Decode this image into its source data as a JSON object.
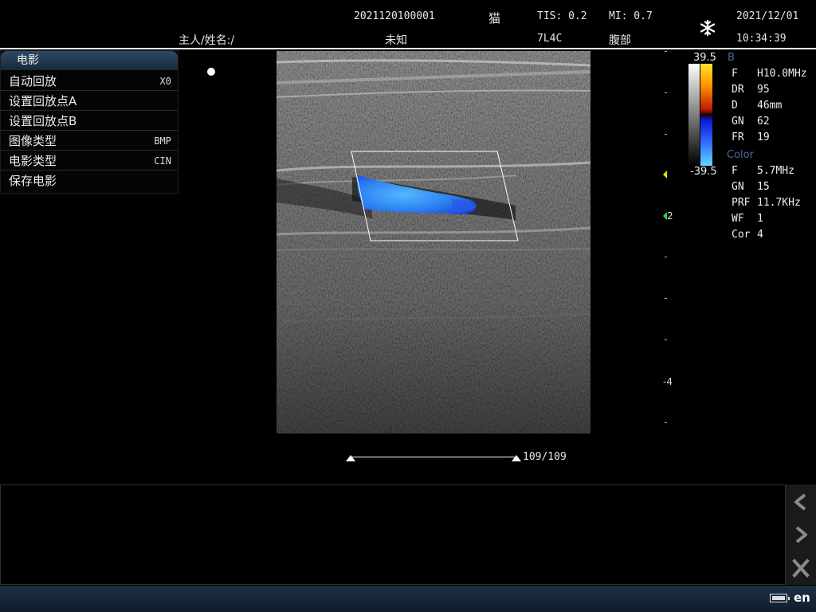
{
  "header": {
    "patient_id": "2021120100001",
    "species": "猫",
    "tis": "TIS: 0.2",
    "mi": "MI: 0.7",
    "date": "2021/12/01",
    "owner_label": "主人/姓名:/",
    "name_value": "未知",
    "probe": "7L4C",
    "exam": "腹部",
    "time": "10:34:39",
    "freeze_icon": "snowflake-icon"
  },
  "menu": {
    "title": "电影",
    "items": [
      {
        "label": "自动回放",
        "value": "X0"
      },
      {
        "label": "设置回放点A",
        "value": ""
      },
      {
        "label": "设置回放点B",
        "value": ""
      },
      {
        "label": "图像类型",
        "value": "BMP"
      },
      {
        "label": "电影类型",
        "value": "CIN"
      },
      {
        "label": "保存电影",
        "value": ""
      }
    ]
  },
  "colorbar": {
    "max": "39.5",
    "min": "-39.5"
  },
  "params": {
    "b_title": "B",
    "b": [
      {
        "k": "F",
        "v": "H10.0MHz"
      },
      {
        "k": "DR",
        "v": "95"
      },
      {
        "k": "D",
        "v": "46mm"
      },
      {
        "k": "GN",
        "v": "62"
      },
      {
        "k": "FR",
        "v": "19"
      }
    ],
    "color_title": "Color",
    "color": [
      {
        "k": "F",
        "v": "5.7MHz"
      },
      {
        "k": "GN",
        "v": "15"
      },
      {
        "k": "PRF",
        "v": "11.7KHz"
      },
      {
        "k": "WF",
        "v": "1"
      },
      {
        "k": "Cor",
        "v": "4"
      }
    ]
  },
  "scale": {
    "label_2": "2",
    "label_4": "-4"
  },
  "cine": {
    "frame": "109/109",
    "progress": 1.0
  },
  "status": {
    "lang": "en",
    "battery_icon": "battery-icon"
  },
  "colors": {
    "accent": "#2f4a66",
    "flow": "#2a8cff"
  }
}
